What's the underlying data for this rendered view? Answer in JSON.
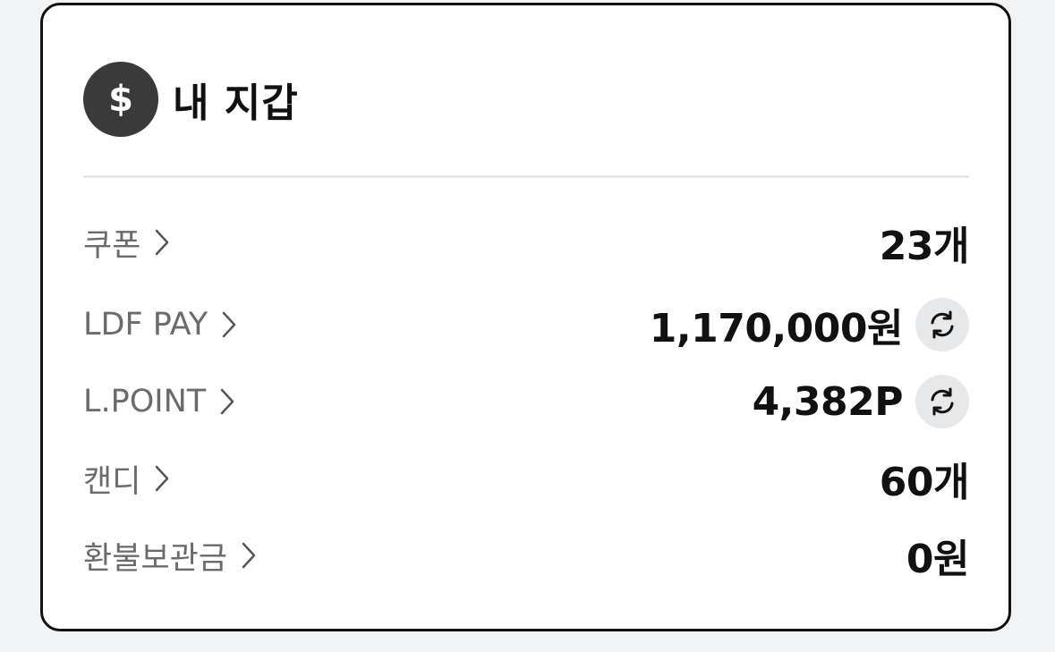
{
  "wallet": {
    "title": "내 지갑",
    "icon": "dollar-coin-icon",
    "items": [
      {
        "label": "쿠폰",
        "value": "23개",
        "refresh": false
      },
      {
        "label": "LDF PAY",
        "value": "1,170,000원",
        "refresh": true
      },
      {
        "label": "L.POINT",
        "value": "4,382P",
        "refresh": true
      },
      {
        "label": "캔디",
        "value": "60개",
        "refresh": false
      },
      {
        "label": "환불보관금",
        "value": "0원",
        "refresh": false
      }
    ]
  },
  "colors": {
    "card_border": "#111111",
    "label_text": "#6b6b6b",
    "value_text": "#111111",
    "coin_bg": "#3a3a3a",
    "refresh_bg": "#e6e8ea",
    "page_bg": "#f1f3f4"
  }
}
